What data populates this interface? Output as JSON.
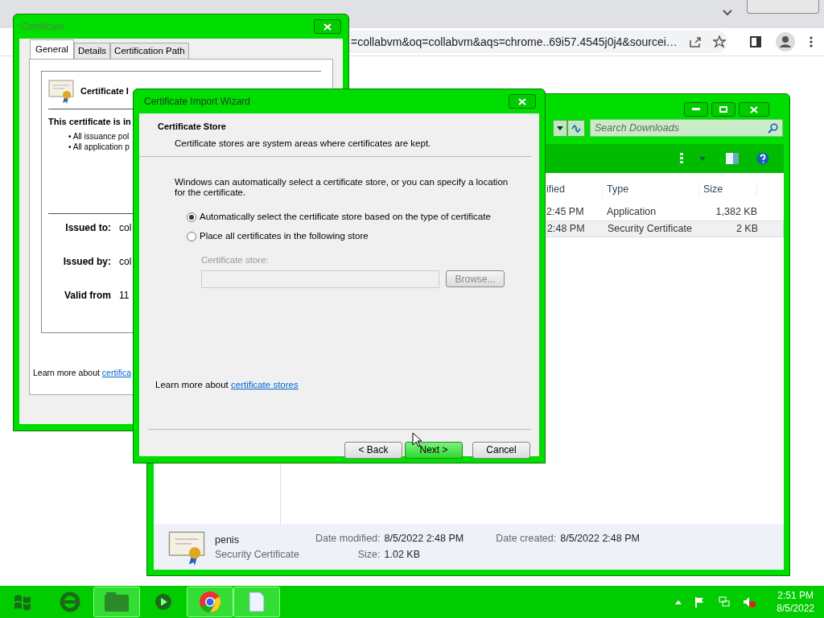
{
  "browser": {
    "address": "=collabvm&oq=collabvm&aqs=chrome..69i57.4545j0j4&sourcei…"
  },
  "certificate_window": {
    "title": "Certificate",
    "tabs": [
      {
        "label": "General",
        "selected": true
      },
      {
        "label": "Details",
        "selected": false
      },
      {
        "label": "Certification Path",
        "selected": false
      }
    ],
    "header": "Certificate I",
    "intended": "This certificate is in",
    "bullets": [
      "• All issuance pol",
      "• All application p"
    ],
    "fields": [
      {
        "label": "Issued to:",
        "value": "col"
      },
      {
        "label": "Issued by:",
        "value": "col"
      },
      {
        "label": "Valid from",
        "value": "11"
      }
    ],
    "learn_text": "Learn more about ",
    "learn_link": "certifica"
  },
  "explorer": {
    "search_placeholder": "Search Downloads",
    "columns": [
      "ified",
      "Type",
      "Size"
    ],
    "rows": [
      {
        "modified": "2:45 PM",
        "type": "Application",
        "size": "1,382 KB",
        "selected": false
      },
      {
        "modified": "2:48 PM",
        "type": "Security Certificate",
        "size": "2 KB",
        "selected": true
      }
    ],
    "details": {
      "name": "penis",
      "type": "Security Certificate",
      "fields": [
        {
          "label": "Date modified:",
          "value": "8/5/2022 2:48 PM"
        },
        {
          "label": "Date created:",
          "value": "8/5/2022 2:48 PM"
        },
        {
          "label": "Size:",
          "value": "1.02 KB"
        }
      ]
    }
  },
  "wizard": {
    "title": "Certificate Import Wizard",
    "heading": "Certificate Store",
    "subheading": "Certificate stores are system areas where certificates are kept.",
    "intro": "Windows can automatically select a certificate store, or you can specify a location for the certificate.",
    "options": [
      {
        "label": "Automatically select the certificate store based on the type of certificate",
        "selected": true
      },
      {
        "label": "Place all certificates in the following store",
        "selected": false
      }
    ],
    "store_label": "Certificate store:",
    "store_disabled": true,
    "browse": "Browse...",
    "learn_text": "Learn more about ",
    "learn_link": "certificate stores",
    "buttons": [
      {
        "label": "< Back",
        "kind": "normal"
      },
      {
        "label": "Next >",
        "kind": "default"
      },
      {
        "label": "Cancel",
        "kind": "normal"
      }
    ]
  },
  "taskbar": {
    "time": "2:51 PM",
    "date": "8/5/2022"
  }
}
